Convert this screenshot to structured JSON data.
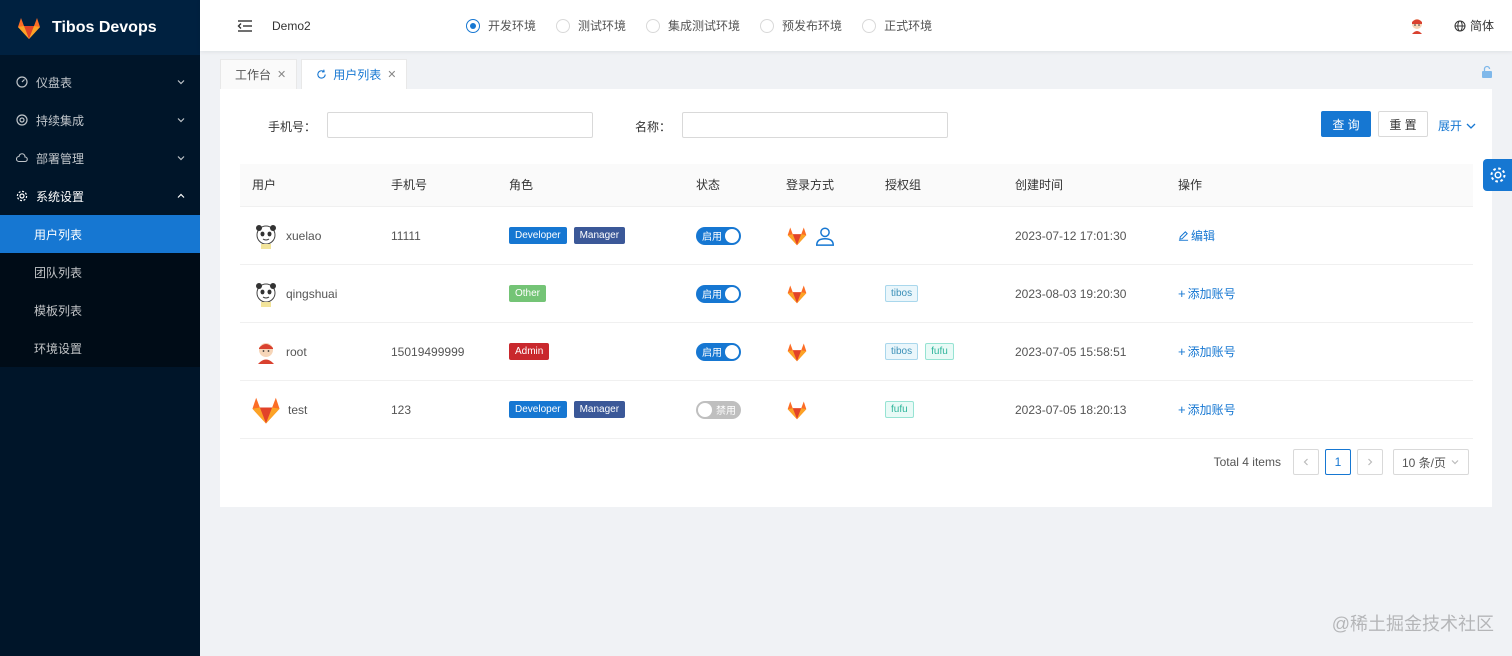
{
  "app": {
    "name": "Tibos Devops"
  },
  "sidebar": {
    "items": [
      {
        "label": "仪盘表",
        "icon": "dashboard-icon"
      },
      {
        "label": "持续集成",
        "icon": "target-icon"
      },
      {
        "label": "部署管理",
        "icon": "cloud-icon"
      },
      {
        "label": "系统设置",
        "icon": "gear-icon"
      }
    ],
    "sub_items": [
      {
        "label": "用户列表",
        "active": true
      },
      {
        "label": "团队列表"
      },
      {
        "label": "模板列表"
      },
      {
        "label": "环境设置"
      }
    ]
  },
  "header": {
    "project": "Demo2",
    "environments": [
      {
        "label": "开发环境",
        "selected": true
      },
      {
        "label": "测试环境"
      },
      {
        "label": "集成测试环境"
      },
      {
        "label": "预发布环境"
      },
      {
        "label": "正式环境"
      }
    ],
    "language": "简体"
  },
  "tabs": [
    {
      "label": "工作台"
    },
    {
      "label": "用户列表",
      "active": true
    }
  ],
  "search": {
    "phone_label": "手机号：",
    "name_label": "名称：",
    "query_button": "查 询",
    "reset_button": "重 置",
    "expand_label": "展开"
  },
  "table": {
    "columns": [
      "用户",
      "手机号",
      "角色",
      "状态",
      "登录方式",
      "授权组",
      "创建时间",
      "操作"
    ],
    "rows": [
      {
        "user": "xuelao",
        "phone": "11111",
        "roles": [
          "Developer",
          "Manager"
        ],
        "status": "启用",
        "enabled": true,
        "logins": [
          "gitlab",
          "account"
        ],
        "groups": [],
        "created": "2023-07-12 17:01:30",
        "action": "编辑"
      },
      {
        "user": "qingshuai",
        "phone": "",
        "roles": [
          "Other"
        ],
        "status": "启用",
        "enabled": true,
        "logins": [
          "gitlab"
        ],
        "groups": [
          "tibos"
        ],
        "created": "2023-08-03 19:20:30",
        "action": "添加账号"
      },
      {
        "user": "root",
        "phone": "15019499999",
        "roles": [
          "Admin"
        ],
        "status": "启用",
        "enabled": true,
        "logins": [
          "gitlab"
        ],
        "groups": [
          "tibos",
          "fufu"
        ],
        "created": "2023-07-05 15:58:51",
        "action": "添加账号"
      },
      {
        "user": "test",
        "phone": "123",
        "roles": [
          "Developer",
          "Manager"
        ],
        "status": "禁用",
        "enabled": false,
        "logins": [
          "gitlab"
        ],
        "groups": [
          "fufu"
        ],
        "created": "2023-07-05 18:20:13",
        "action": "添加账号"
      }
    ]
  },
  "pagination": {
    "total": "Total 4 items",
    "current_page": "1",
    "page_size": "10 条/页"
  },
  "watermark": "@稀土掘金技术社区",
  "colors": {
    "primary": "#1677d2",
    "sidebar": "#001529"
  }
}
